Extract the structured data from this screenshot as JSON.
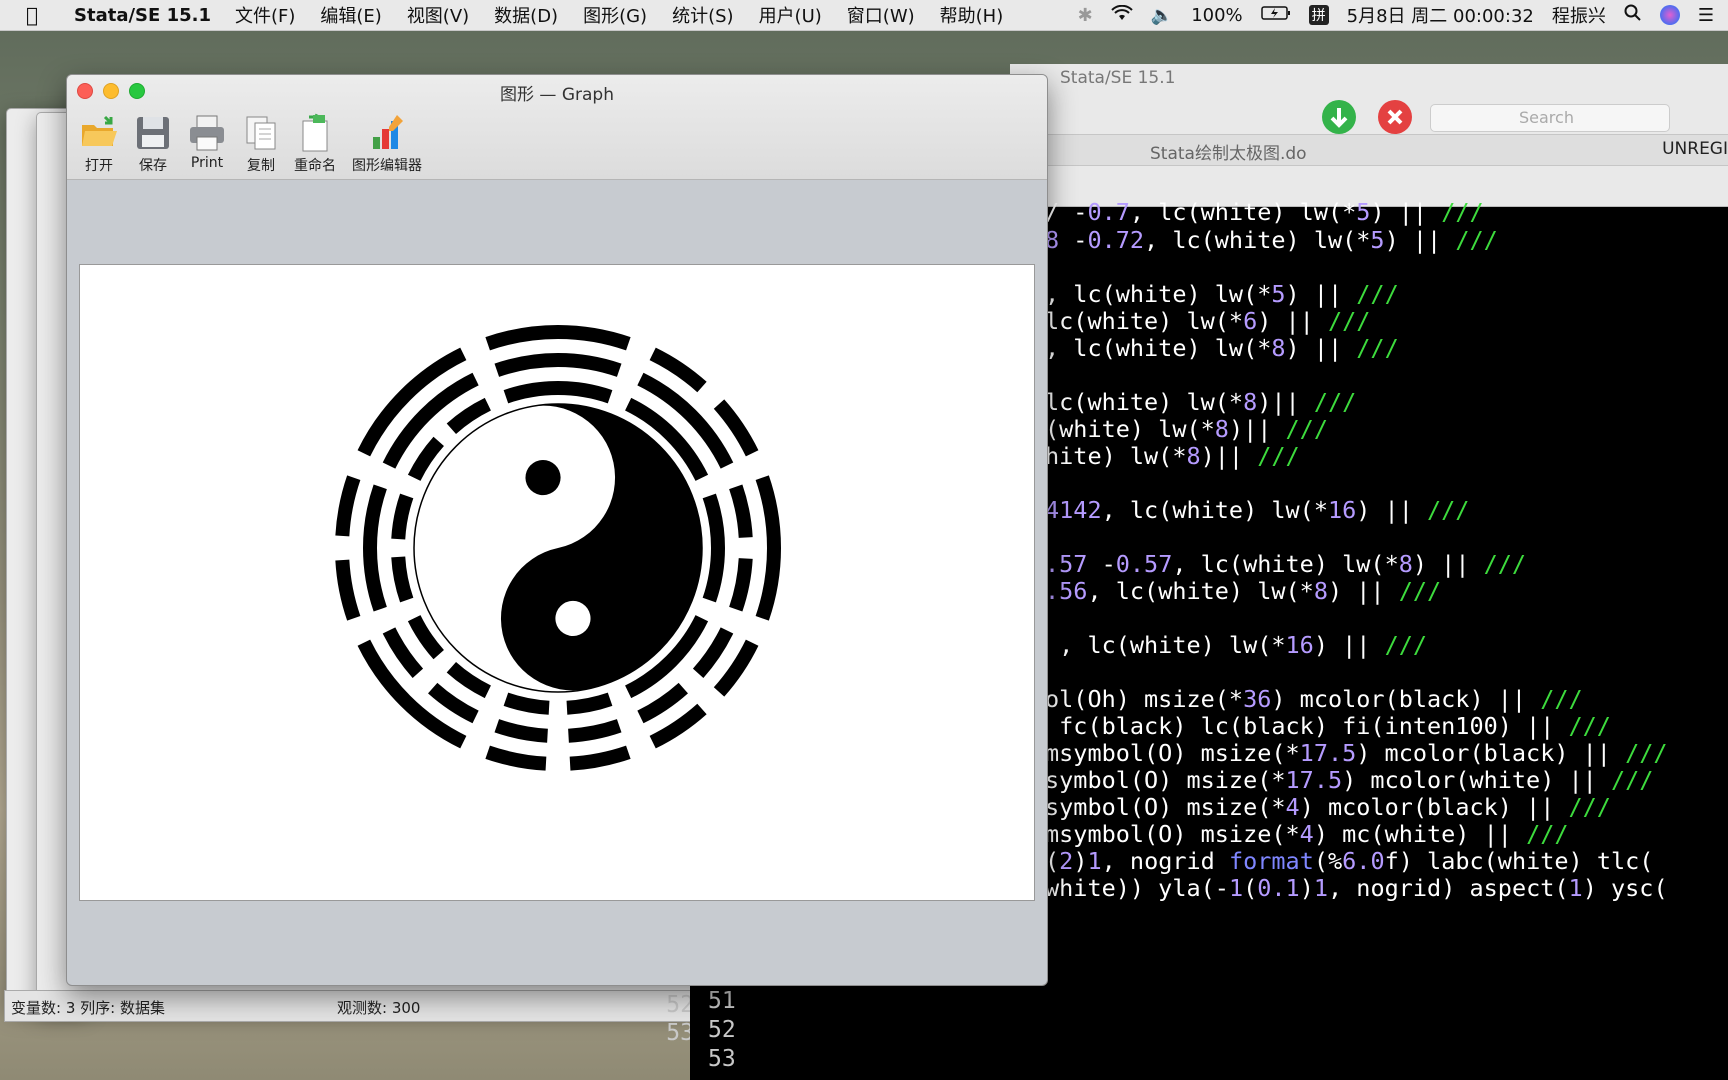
{
  "menubar": {
    "app_name": "Stata/SE 15.1",
    "items": [
      "文件(F)",
      "编辑(E)",
      "视图(V)",
      "数据(D)",
      "图形(G)",
      "统计(S)",
      "用户(U)",
      "窗口(W)",
      "帮助(H)"
    ],
    "battery": "100%",
    "input_method": "拼",
    "datetime": "5月8日 周二 00:00:32",
    "user": "程振兴"
  },
  "graph_window": {
    "title": "图形 — Graph",
    "toolbar": {
      "open": "打开",
      "save": "保存",
      "print": "Print",
      "copy": "复制",
      "rename": "重命名",
      "graph_editor": "图形编辑器"
    }
  },
  "editor": {
    "window_title": "Stata/SE 15.1",
    "tab_name": "Stata绘制太极图.do",
    "search_placeholder": "Search",
    "unregistered": "UNREGI",
    "line_numbers": [
      "51",
      "52",
      "53"
    ]
  },
  "data_window": {
    "status_left": "变量数: 3  列序: 数据集",
    "status_right": "观测数: 300"
  },
  "colors": {
    "number": "#b59bff",
    "comment": "#3ddb3d",
    "keyword": "#7f86ff",
    "green_button": "#34b34a",
    "red_button": "#e44141"
  }
}
